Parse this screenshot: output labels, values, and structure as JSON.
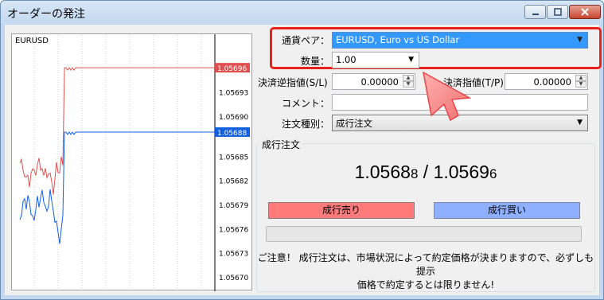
{
  "window": {
    "title": "オーダーの発注",
    "minimize_icon": "minimize-icon",
    "maximize_icon": "maximize-icon",
    "close_icon": "close-icon"
  },
  "chart": {
    "symbol": "EURUSD",
    "price_levels": [
      "1.05696",
      "1.05693",
      "1.05690",
      "1.05688",
      "1.05685",
      "1.05682",
      "1.05679",
      "1.05676",
      "1.05673",
      "1.05670"
    ],
    "ask_label": "1.05696",
    "bid_label": "1.05688",
    "ask_color": "#e05050",
    "bid_color": "#1060e0"
  },
  "form": {
    "symbol_label": "通貨ペア：",
    "symbol_value": "EURUSD, Euro vs US Dollar",
    "volume_label": "数量：",
    "volume_value": "1.00",
    "stop_loss_label": "決済逆指値(S/L)",
    "stop_loss_value": "0.00000",
    "take_profit_label": "決済指値(T/P)",
    "take_profit_value": "0.00000",
    "comment_label": "コメント：",
    "comment_value": "",
    "order_type_label": "注文種別：",
    "order_type_value": "成行注文"
  },
  "market": {
    "group_title": "成行注文",
    "bid_main": "1.0568",
    "bid_small": "8",
    "separator": " / ",
    "ask_main": "1.0569",
    "ask_small": "6",
    "sell_button": "成行売り",
    "buy_button": "成行買い",
    "sell_color": "#ff7b7b",
    "buy_color": "#8fb0ff",
    "notice_line1": "ご注意！ 成行注文は、市場状況によって約定価格が決まりますので、必ずしも提示",
    "notice_line2": "価格で約定するとは限りません!"
  },
  "annotation": {
    "highlight_color": "#e8201a",
    "pointer_icon": "arrow-pointer-icon"
  }
}
